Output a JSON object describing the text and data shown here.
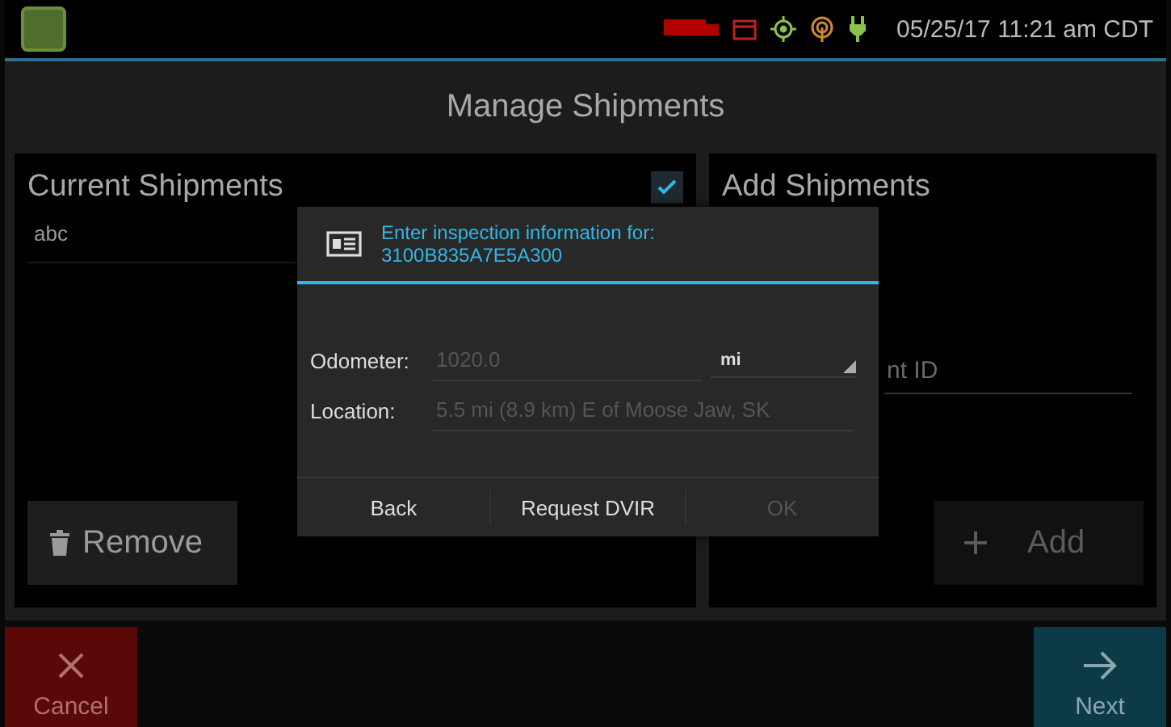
{
  "status_bar": {
    "datetime": "05/25/17 11:21 am CDT"
  },
  "title": "Manage Shipments",
  "current_shipments": {
    "heading": "Current Shipments",
    "select_all_checked": true,
    "items": [
      "abc"
    ],
    "remove_button": "Remove"
  },
  "add_shipments": {
    "heading": "Add Shipments",
    "id_field": {
      "placeholder": "nt ID"
    },
    "add_button": {
      "label": "Add",
      "disabled": true
    }
  },
  "dialog": {
    "title": "Enter inspection information for:",
    "subtitle": "3100B835A7E5A300",
    "odometer": {
      "label": "Odometer:",
      "placeholder": "1020.0",
      "unit": "mi"
    },
    "location": {
      "label": "Location:",
      "placeholder": "5.5 mi (8.9 km) E of Moose Jaw, SK"
    },
    "buttons": [
      {
        "label": "Back",
        "disabled": false
      },
      {
        "label": "Request DVIR",
        "disabled": false
      },
      {
        "label": "OK",
        "disabled": true
      }
    ]
  },
  "bottom_bar": {
    "cancel": "Cancel",
    "next": "Next"
  }
}
